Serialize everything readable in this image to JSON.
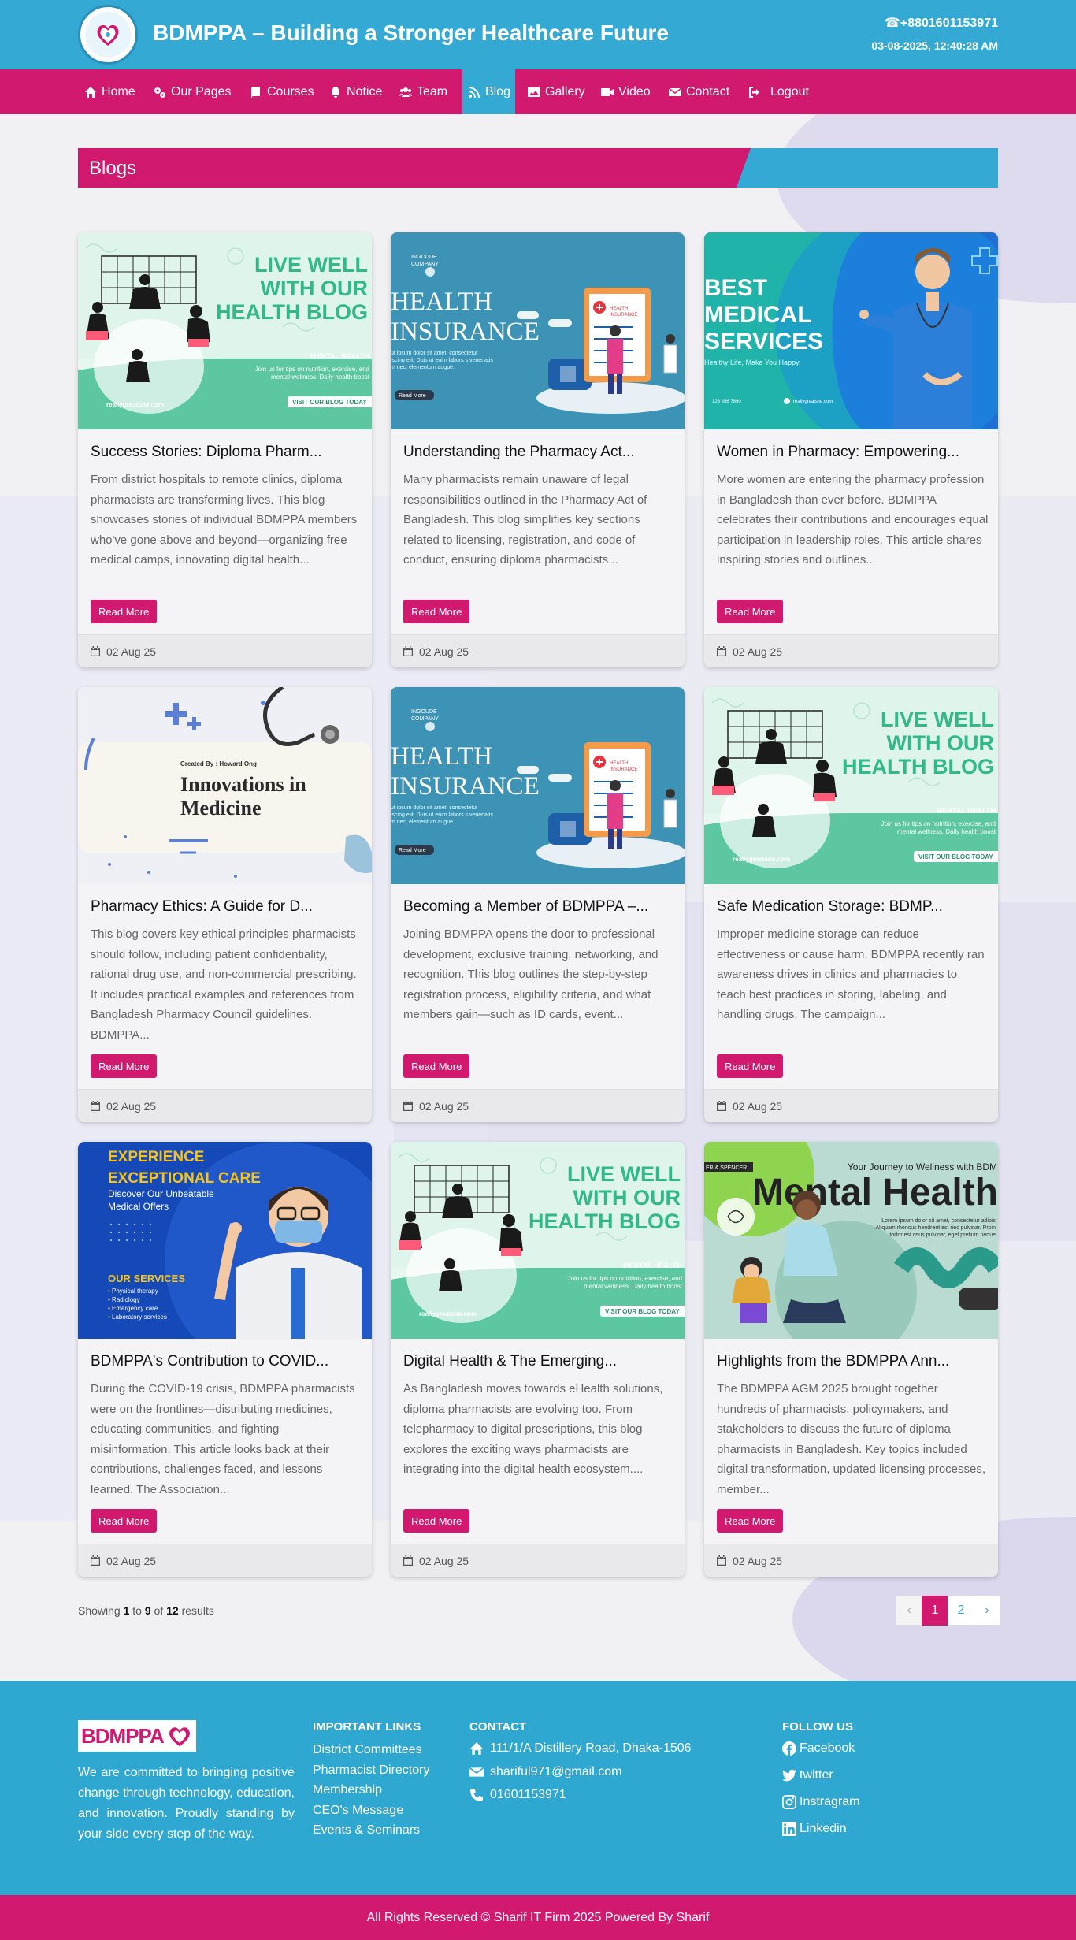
{
  "header": {
    "title": "BDMPPA – Building a Stronger Healthcare Future",
    "phone": "+8801601153971",
    "datetime": "03-08-2025, 12:40:28 AM"
  },
  "nav": [
    {
      "label": "Home",
      "icon": "home-icon"
    },
    {
      "label": "Our Pages",
      "icon": "gears-icon"
    },
    {
      "label": "Courses",
      "icon": "book-icon"
    },
    {
      "label": "Notice",
      "icon": "bell-icon"
    },
    {
      "label": "Team",
      "icon": "users-icon"
    },
    {
      "label": "Blog",
      "icon": "blog-icon",
      "active": true
    },
    {
      "label": "Gallery",
      "icon": "image-icon"
    },
    {
      "label": "Video",
      "icon": "video-icon"
    },
    {
      "label": "Contact",
      "icon": "envelope-icon"
    },
    {
      "label": "Logout",
      "icon": "logout-icon"
    }
  ],
  "section_title": "Blogs",
  "read_more": "Read More",
  "posts": [
    {
      "title": "Success Stories: Diploma Pharm...",
      "excerpt": "From district hospitals to remote clinics, diploma pharmacists are transforming lives. This blog showcases stories of individual BDMPPA members who've gone above and beyond—organizing free medical camps, innovating digital health...",
      "date": "02 Aug 25",
      "image": "live-well-health-blog-banner"
    },
    {
      "title": "Understanding the Pharmacy Act...",
      "excerpt": "Many pharmacists remain unaware of legal responsibilities outlined in the Pharmacy Act of Bangladesh. This blog simplifies key sections related to licensing, registration, and code of conduct, ensuring diploma pharmacists...",
      "date": "02 Aug 25",
      "image": "health-insurance-banner"
    },
    {
      "title": "Women in Pharmacy: Empowering...",
      "excerpt": "More women are entering the pharmacy profession in Bangladesh than ever before. BDMPPA celebrates their contributions and encourages equal participation in leadership roles. This article shares inspiring stories and outlines...",
      "date": "02 Aug 25",
      "image": "best-medical-services-banner"
    },
    {
      "title": "Pharmacy Ethics: A Guide for D...",
      "excerpt": "This blog covers key ethical principles pharmacists should follow, including patient confidentiality, rational drug use, and non-commercial prescribing. It includes practical examples and references from Bangladesh Pharmacy Council guidelines. BDMPPA...",
      "date": "02 Aug 25",
      "image": "innovations-in-medicine-banner"
    },
    {
      "title": "Becoming a Member of BDMPPA –...",
      "excerpt": "Joining BDMPPA opens the door to professional development, exclusive training, networking, and recognition. This blog outlines the step-by-step registration process, eligibility criteria, and what members gain—such as ID cards, event...",
      "date": "02 Aug 25",
      "image": "health-insurance-banner"
    },
    {
      "title": "Safe Medication Storage: BDMP...",
      "excerpt": "Improper medicine storage can reduce effectiveness or cause harm. BDMPPA recently ran awareness drives in clinics and pharmacies to teach best practices in storing, labeling, and handling drugs. The campaign...",
      "date": "02 Aug 25",
      "image": "live-well-health-blog-banner"
    },
    {
      "title": "BDMPPA's Contribution to COVID...",
      "excerpt": "During the COVID-19 crisis, BDMPPA pharmacists were on the frontlines—distributing medicines, educating communities, and fighting misinformation. This article looks back at their contributions, challenges faced, and lessons learned. The Association...",
      "date": "02 Aug 25",
      "image": "exceptional-care-banner"
    },
    {
      "title": "Digital Health & The Emerging...",
      "excerpt": "As Bangladesh moves towards eHealth solutions, diploma pharmacists are evolving too. From telepharmacy to digital prescriptions, this blog explores the exciting ways pharmacists are integrating into the digital health ecosystem....",
      "date": "02 Aug 25",
      "image": "live-well-health-blog-banner"
    },
    {
      "title": "Highlights from the BDMPPA Ann...",
      "excerpt": "The BDMPPA AGM 2025 brought together hundreds of pharmacists, policymakers, and stakeholders to discuss the future of diploma pharmacists in Bangladesh. Key topics included digital transformation, updated licensing processes, member...",
      "date": "02 Aug 25",
      "image": "mental-health-banner"
    }
  ],
  "banner_text": {
    "live_well": [
      "LIVE WELL",
      "WITH OUR",
      "HEALTH BLOG"
    ],
    "mental_health": "MENTAL HEALTH",
    "site": "reallygreatsite.com",
    "visit": "VISIT OUR BLOG TODAY",
    "insurance": [
      "HEALTH",
      "INSURANCE"
    ],
    "company": "INGOUDE COMPANY",
    "best": [
      "BEST",
      "MEDICAL",
      "SERVICES"
    ],
    "healthy": "Healthy Life, Make You Happy.",
    "innov_by": "Created By : Howard Ong",
    "innov": [
      "Innovations in",
      "Medicine"
    ],
    "exp": [
      "EXPERIENCE",
      "EXCEPTIONAL CARE"
    ],
    "discover": [
      "Discover Our Unbeatable",
      "Medical Offers"
    ],
    "services_h": "OUR SERVICES",
    "services": [
      "• Physical therapy",
      "• Radiology",
      "• Emergency care",
      "• Laboratory services"
    ],
    "journey": "Your Journey to Wellness with BDM",
    "mental": "Mental Health"
  },
  "pagination": {
    "showing_prefix": "Showing",
    "from": "1",
    "to_word": "to",
    "to": "9",
    "of_word": "of",
    "total": "12",
    "suffix": "results",
    "prev": "‹",
    "pages": [
      "1",
      "2"
    ],
    "next": "›",
    "current": "1"
  },
  "footer": {
    "logo_text": "BDMPPA",
    "description": "We are committed to bringing positive change through technology, education, and innovation. Proudly standing by your side every step of the way.",
    "links_heading": "IMPORTANT LINKS",
    "links": [
      "District Committees",
      "Pharmacist Directory",
      "Membership",
      "CEO's Message",
      "Events & Seminars"
    ],
    "contact_heading": "CONTACT",
    "address": "111/1/A Distillery Road, Dhaka-1506",
    "email": "shariful971@gmail.com",
    "phone": "01601153971",
    "follow_heading": "FOLLOW US",
    "social": [
      "Facebook",
      "twitter",
      "Instragram",
      "Linkedin"
    ]
  },
  "copyright": "All Rights Reserved © Sharif IT Firm 2025 Powered By Sharif",
  "colors": {
    "blue": "#33a9d3",
    "pink": "#d11a6f",
    "footer_blue": "#2ea7d1"
  }
}
